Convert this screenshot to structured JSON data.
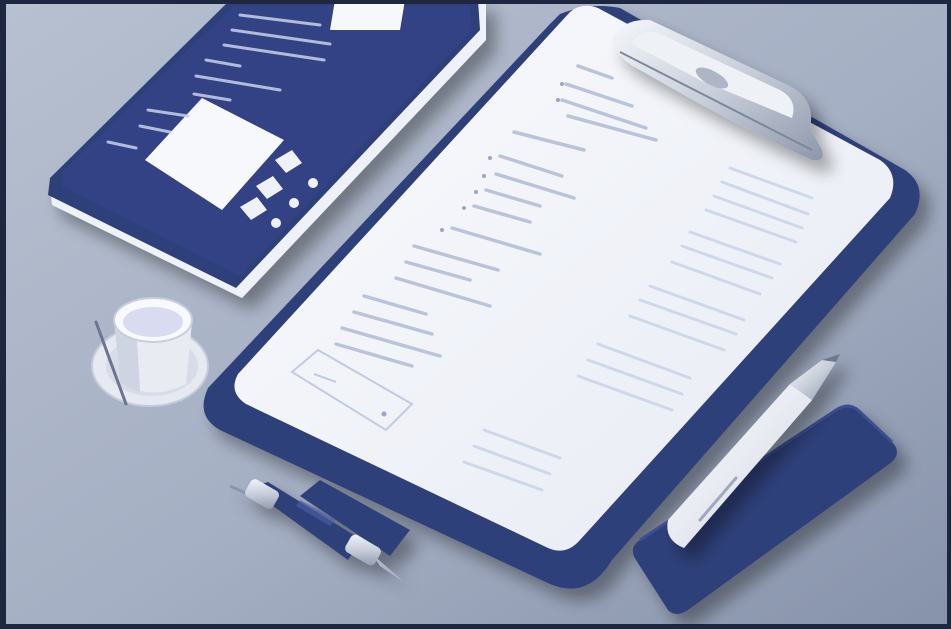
{
  "scene": {
    "description_visible_text": "",
    "colors": {
      "frame": "#1d2740",
      "desk_top": "#c5ccd8",
      "desk_bottom": "#8f9bb2",
      "navy": "#2f3f7a",
      "navy_dark": "#233064",
      "paper": "#f3f5fa",
      "paper_lines": "#c7d0e4",
      "silver": "#d7dbe4",
      "cup": "#e9ebf3"
    },
    "icons": {
      "clipboard": "clipboard-icon",
      "tablet": "tablet-icon",
      "pen": "pen-icon",
      "cup": "cup-icon"
    }
  }
}
